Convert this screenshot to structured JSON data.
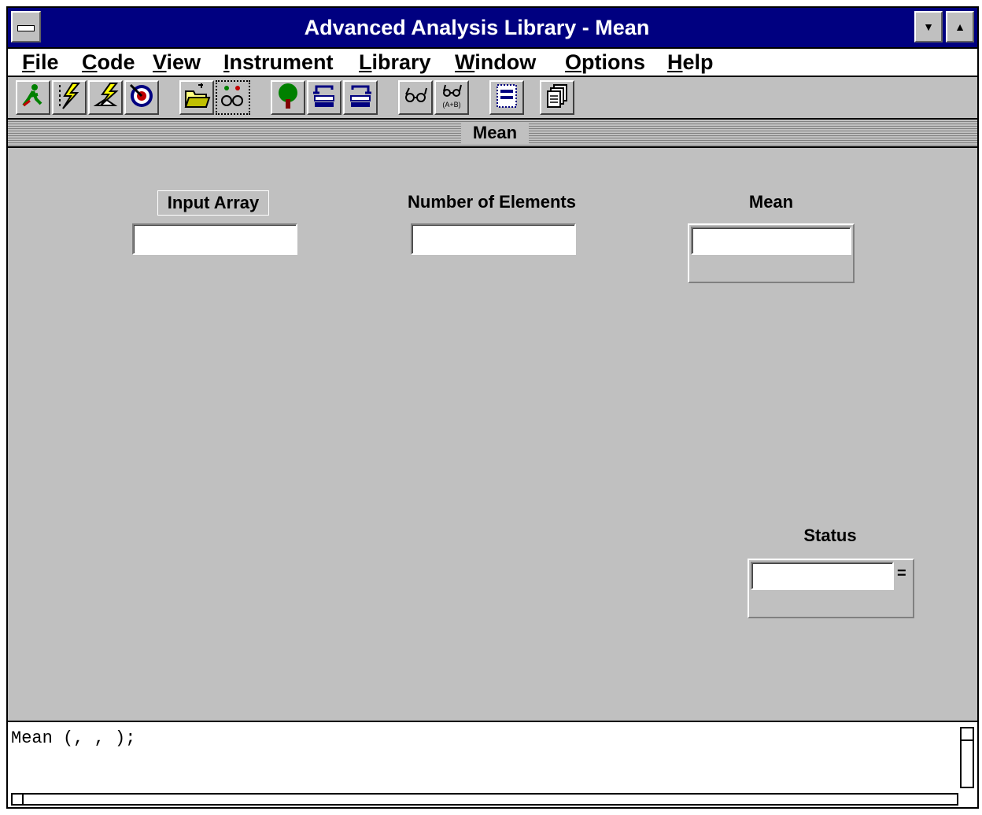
{
  "window": {
    "title": "Advanced Analysis Library - Mean",
    "minimize_glyph": "▼",
    "maximize_glyph": "▲"
  },
  "menu": {
    "items": [
      {
        "label": "File"
      },
      {
        "label": "Code"
      },
      {
        "label": "View"
      },
      {
        "label": "Instrument"
      },
      {
        "label": "Library"
      },
      {
        "label": "Window"
      },
      {
        "label": "Options"
      },
      {
        "label": "Help"
      }
    ]
  },
  "toolbar": {
    "icons": [
      "run-icon",
      "lightning-icon",
      "run-step-icon",
      "target-icon",
      "open-folder-icon",
      "binoculars-icon",
      "tree-icon",
      "insert-top-icon",
      "insert-bottom-icon",
      "glasses-icon",
      "glasses-ab-icon",
      "panel-icon",
      "copies-icon"
    ],
    "glasses_ab_text": "(A+B)"
  },
  "panel": {
    "title": "Mean",
    "fields": {
      "input_array_label": "Input Array",
      "input_array_value": "",
      "num_elements_label": "Number of Elements",
      "num_elements_value": "",
      "mean_label": "Mean",
      "mean_value": "",
      "status_label": "Status",
      "status_value": "",
      "status_equals": "="
    }
  },
  "code": {
    "text": "Mean (, , );"
  },
  "colors": {
    "titlebar": "#000080",
    "panel_bg": "#c0c0c0"
  }
}
